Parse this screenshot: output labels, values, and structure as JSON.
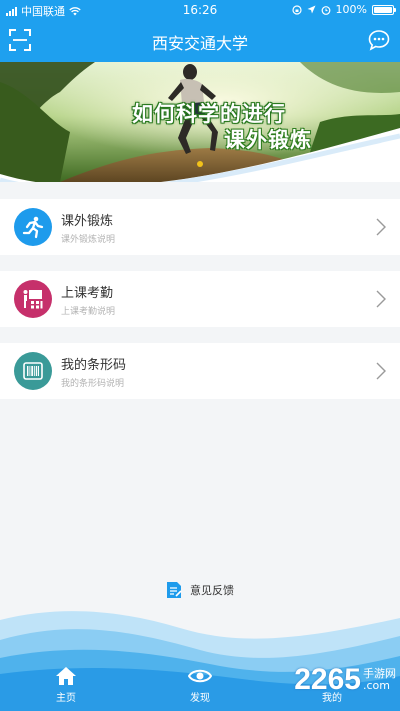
{
  "status": {
    "carrier": "中国联通",
    "time": "16:26",
    "battery": "100%"
  },
  "header": {
    "title": "西安交通大学",
    "scan_icon": "scan-icon",
    "chat_icon": "chat-bubble-icon"
  },
  "banner": {
    "line1": "如何科学的进行",
    "line2": "课外锻炼"
  },
  "menu": [
    {
      "title": "课外锻炼",
      "subtitle": "课外锻炼说明",
      "icon": "running-icon",
      "color": "#1e9bec"
    },
    {
      "title": "上课考勤",
      "subtitle": "上课考勤说明",
      "icon": "attendance-icon",
      "color": "#c6306b"
    },
    {
      "title": "我的条形码",
      "subtitle": "我的条形码说明",
      "icon": "barcode-icon",
      "color": "#3a9a98"
    }
  ],
  "feedback": {
    "label": "意见反馈"
  },
  "tabs": [
    {
      "label": "主页",
      "icon": "home-icon"
    },
    {
      "label": "发现",
      "icon": "eye-icon"
    },
    {
      "label": "我的",
      "icon": "user-icon"
    }
  ],
  "watermark": {
    "number": "2265",
    "line1": "手游网",
    "line2": ".com"
  }
}
